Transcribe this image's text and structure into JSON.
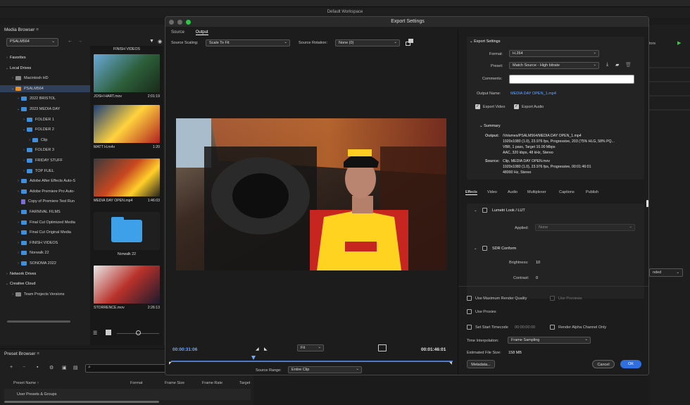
{
  "workspace_label": "Default Workspace",
  "media_browser": {
    "title": "Media Browser",
    "device": "PSALM564",
    "tree": [
      {
        "label": "Favorites",
        "level": 0,
        "arrow": "›",
        "icon": "none"
      },
      {
        "label": "Local Drives",
        "level": 0,
        "arrow": "⌄",
        "icon": "none"
      },
      {
        "label": "Macintosh HD",
        "level": 1,
        "arrow": "›",
        "icon": "grey"
      },
      {
        "label": "PSALM564",
        "level": 1,
        "arrow": "⌄",
        "icon": "orange",
        "selected": true
      },
      {
        "label": "2022 BRISTOL",
        "level": 2,
        "arrow": "›",
        "icon": "blue"
      },
      {
        "label": "2023 MEDIA DAY",
        "level": 2,
        "arrow": "⌄",
        "icon": "blue"
      },
      {
        "label": "FOLDER 1",
        "level": 3,
        "arrow": "›",
        "icon": "blue"
      },
      {
        "label": "FOLDER 2",
        "level": 3,
        "arrow": "⌄",
        "icon": "blue"
      },
      {
        "label": "Clip",
        "level": 4,
        "arrow": "›",
        "icon": "blue"
      },
      {
        "label": "FOLDER 3",
        "level": 3,
        "arrow": "›",
        "icon": "blue"
      },
      {
        "label": "FRIDAY STUFF",
        "level": 3,
        "arrow": "›",
        "icon": "blue"
      },
      {
        "label": "TOP FUEL",
        "level": 3,
        "arrow": "›",
        "icon": "blue"
      },
      {
        "label": "Adobe After Effects Auto-S",
        "level": 2,
        "arrow": "›",
        "icon": "blue"
      },
      {
        "label": "Adobe Premiere Pro Auto-",
        "level": 2,
        "arrow": "›",
        "icon": "blue"
      },
      {
        "label": "Copy of Premiere Test Run",
        "level": 2,
        "arrow": "",
        "icon": "file"
      },
      {
        "label": "FARNIVAL FILMS",
        "level": 2,
        "arrow": "›",
        "icon": "blue"
      },
      {
        "label": "Final Cut Optimized Media",
        "level": 2,
        "arrow": "›",
        "icon": "blue"
      },
      {
        "label": "Final Cut Original Media",
        "level": 2,
        "arrow": "›",
        "icon": "blue"
      },
      {
        "label": "FINISH VIDEOS",
        "level": 2,
        "arrow": "›",
        "icon": "blue"
      },
      {
        "label": "Norwalk 22",
        "level": 2,
        "arrow": "›",
        "icon": "blue"
      },
      {
        "label": "SONOMA 2022",
        "level": 2,
        "arrow": "›",
        "icon": "blue"
      },
      {
        "label": "Network Drives",
        "level": 0,
        "arrow": "›",
        "icon": "none"
      },
      {
        "label": "Creative Cloud",
        "level": 0,
        "arrow": "⌄",
        "icon": "none"
      },
      {
        "label": "Team Projects Versions",
        "level": 1,
        "arrow": "›",
        "icon": "grey"
      }
    ],
    "thumbnails": [
      {
        "name": "FINISH VIDEOS",
        "duration": "",
        "top_only": true
      },
      {
        "name": "JOSH HART.mov",
        "duration": "2:01:19"
      },
      {
        "name": "MATT H.m4v",
        "duration": "1:20"
      },
      {
        "name": "MEDIA DAY OPEN.mp4",
        "duration": "1:46:03"
      },
      {
        "name": "Norwalk 22",
        "duration": "",
        "folder": true
      },
      {
        "name": "STORRENCE.mov",
        "duration": "2:26:13"
      }
    ]
  },
  "preset_browser": {
    "title": "Preset Browser",
    "columns": [
      "Preset Name",
      "Format",
      "Frame Size",
      "Frame Rate",
      "Target"
    ],
    "row": "User Presets & Groups"
  },
  "right_panel": {
    "label": "tors",
    "dropdown": "nded"
  },
  "dialog": {
    "title": "Export Settings",
    "tabs": [
      "Source",
      "Output"
    ],
    "source_scaling_label": "Source Scaling:",
    "source_scaling_value": "Scale To Fit",
    "source_rotation_label": "Source Rotation:",
    "source_rotation_value": "None (0)",
    "timecode_current": "00:00:31:06",
    "timecode_end": "00:01:46:01",
    "fit_value": "Fit",
    "source_range_label": "Source Range:",
    "source_range_value": "Entire Clip",
    "export_settings_header": "Export Settings",
    "format_label": "Format:",
    "format_value": "H.264",
    "preset_label": "Preset:",
    "preset_value": "Match Source - High bitrate",
    "comments_label": "Comments:",
    "output_name_label": "Output Name:",
    "output_name_value": "MEDIA DAY OPEN_1.mp4",
    "export_video": "Export Video",
    "export_audio": "Export Audio",
    "summary_header": "Summary",
    "output_summary_label": "Output:",
    "output_summary_lines": [
      "/Volumes/PSALM564/MEDIA DAY OPEN_1.mp4",
      "1920x1080 (1.0), 23.976 fps, Progressive, 203 (75% HLG, 58% PQ...",
      "VBR, 1 pass, Target 10.00 Mbps",
      "AAC, 320 kbps, 48 kHz, Stereo"
    ],
    "source_summary_label": "Source:",
    "source_summary_lines": [
      "Clip, MEDIA DAY OPEN.mov",
      "1920x1080 (1.0), 23.976 fps, Progressive, 00:01:46:01",
      "48000 Hz, Stereo"
    ],
    "effect_tabs": [
      "Effects",
      "Video",
      "Audio",
      "Multiplexer",
      "Captions",
      "Publish"
    ],
    "lumetri_label": "Lumetri Look / LUT",
    "applied_label": "Applied:",
    "applied_value": "None",
    "sdr_label": "SDR Conform",
    "brightness_label": "Brightness:",
    "brightness_value": "10",
    "contrast_label": "Contrast:",
    "contrast_value": "0",
    "use_max_render": "Use Maximum Render Quality",
    "use_previews": "Use Previews",
    "use_proxies": "Use Proxies",
    "set_start_tc": "Set Start Timecode",
    "start_tc_value": "00:00:00:00",
    "render_alpha": "Render Alpha Channel Only",
    "time_interp_label": "Time Interpolation:",
    "time_interp_value": "Frame Sampling",
    "est_size_label": "Estimated File Size:",
    "est_size_value": "158 MB",
    "metadata_btn": "Metadata...",
    "cancel_btn": "Cancel",
    "ok_btn": "OK"
  }
}
